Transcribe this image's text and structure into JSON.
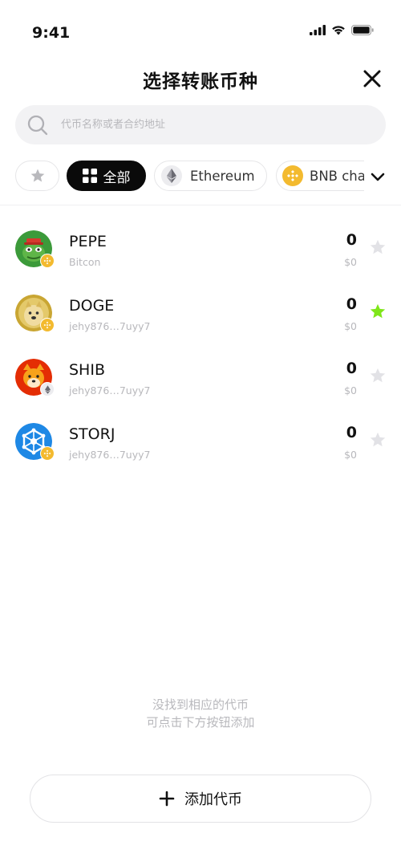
{
  "status_bar": {
    "time": "9:41"
  },
  "header": {
    "title": "选择转账币种"
  },
  "search": {
    "placeholder": "代币名称或者合约地址"
  },
  "filters": {
    "all_label": "全部",
    "ethereum_label": "Ethereum",
    "bnb_label": "BNB chain"
  },
  "tokens": [
    {
      "symbol": "PEPE",
      "sub": "Bitcon",
      "amount": "0",
      "value": "$0",
      "favorite": false,
      "chain": "bnb"
    },
    {
      "symbol": "DOGE",
      "sub": "jehy876…7uyy7",
      "amount": "0",
      "value": "$0",
      "favorite": true,
      "chain": "bnb"
    },
    {
      "symbol": "SHIB",
      "sub": "jehy876…7uyy7",
      "amount": "0",
      "value": "$0",
      "favorite": false,
      "chain": "ethereum"
    },
    {
      "symbol": "STORJ",
      "sub": "jehy876…7uyy7",
      "amount": "0",
      "value": "$0",
      "favorite": false,
      "chain": "bnb"
    }
  ],
  "empty_note": {
    "line1": "没找到相应的代币",
    "line2": "可点击下方按钮添加"
  },
  "add_button": {
    "label": "添加代币"
  },
  "colors": {
    "favorite_star": "#7fe619",
    "inactive_star": "#e2e2e6",
    "bnb_yellow": "#f3ba2f",
    "selected_chip": "#0a0a0a"
  }
}
